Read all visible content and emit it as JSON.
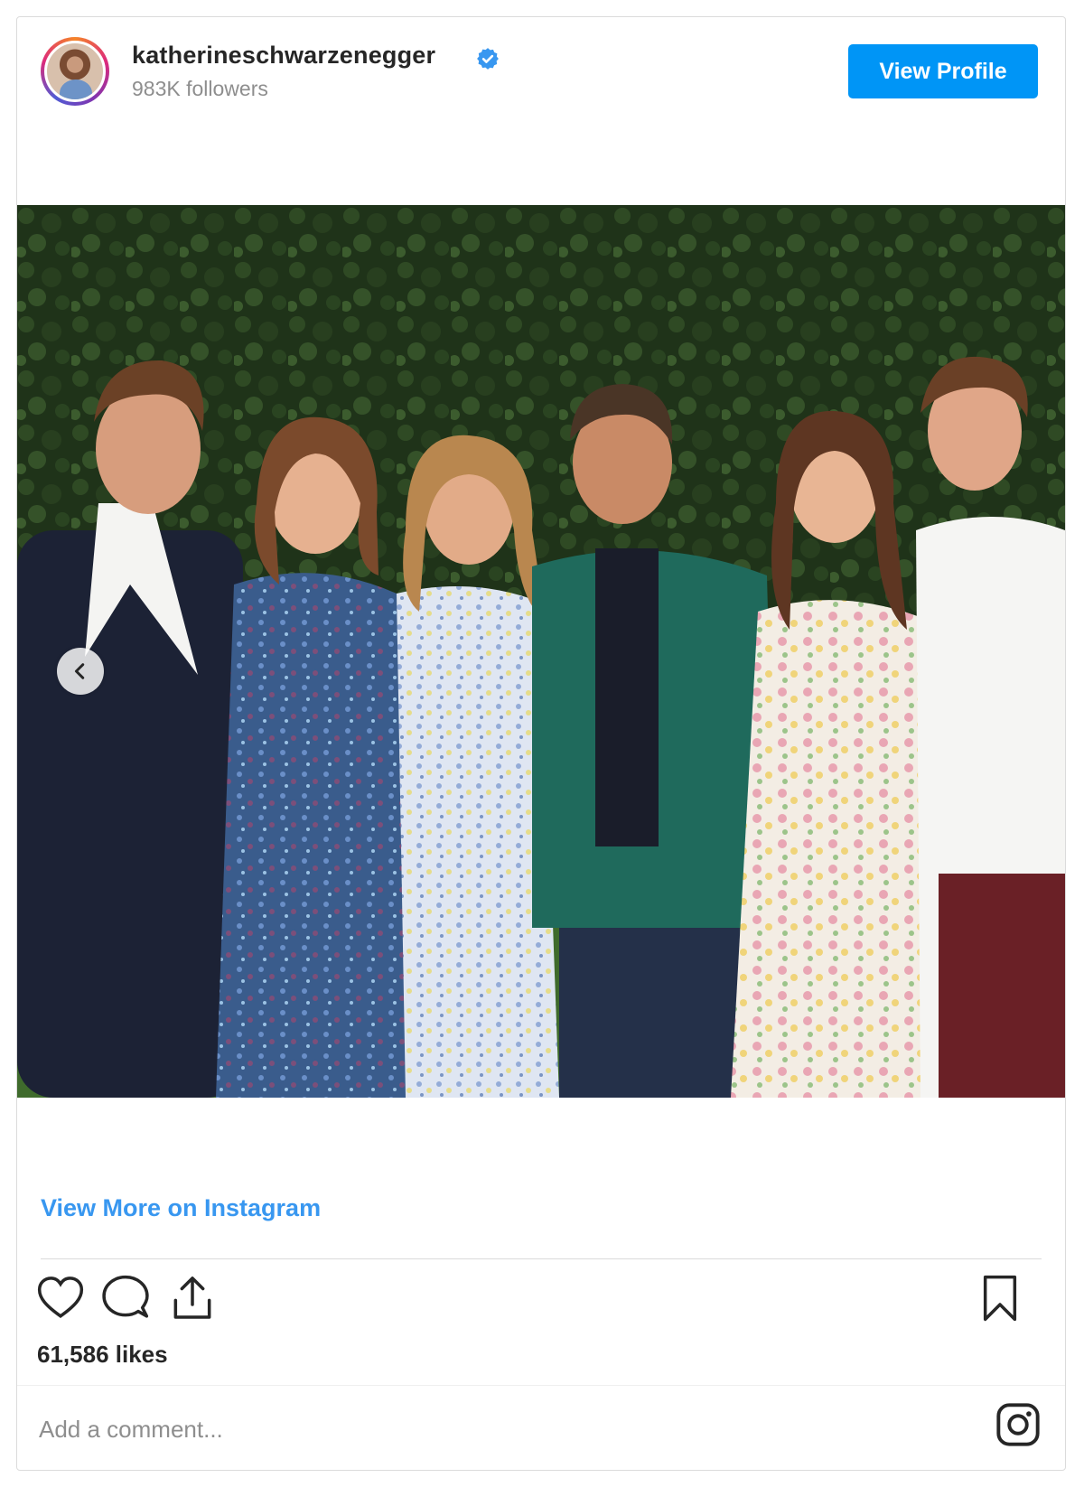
{
  "header": {
    "username": "katherineschwarzenegger",
    "followers": "983K followers",
    "verified": true,
    "view_profile_label": "View Profile"
  },
  "post": {
    "image_alt": "Family photo of six people standing in front of a hedge",
    "carousel": {
      "prev_icon": "chevron-left-icon"
    }
  },
  "links": {
    "view_more_label": "View More on Instagram"
  },
  "actions": {
    "icons": [
      "heart-icon",
      "comment-icon",
      "share-icon",
      "bookmark-icon"
    ],
    "likes_text": "61,586 likes"
  },
  "comment": {
    "placeholder": "Add a comment..."
  },
  "colors": {
    "accent_blue": "#0095f6",
    "link_blue": "#3897f0",
    "text_primary": "#262626",
    "text_secondary": "#8e8e8e",
    "border": "#dbdbdb"
  }
}
